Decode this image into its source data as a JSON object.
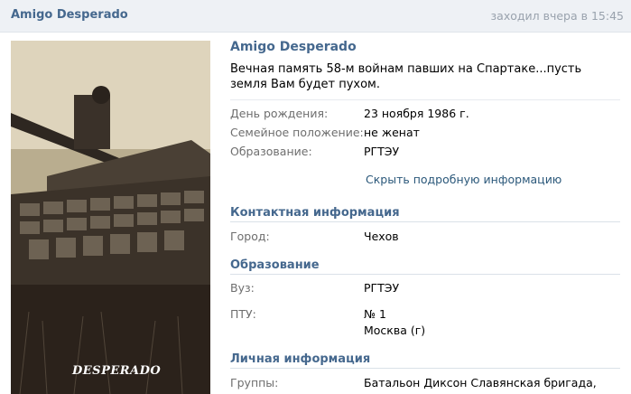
{
  "header": {
    "name": "Amigo Desperado",
    "status": "заходил вчера в 15:45"
  },
  "photo": {
    "caption": "DESPERADO"
  },
  "profile": {
    "name": "Amigo Desperado",
    "status_text": "Вечная память 58-м войнам павших на Спартаке...пусть земля Вам будет пухом.",
    "birthday_label": "День рождения:",
    "birthday_value": "23 ноября 1986 г.",
    "family_label": "Семейное положение:",
    "family_value": "не женат",
    "education_label": "Образование:",
    "education_value": "РГТЭУ",
    "toggle_link": "Скрыть подробную информацию"
  },
  "contact": {
    "title": "Контактная информация",
    "city_label": "Город:",
    "city_value": "Чехов"
  },
  "education": {
    "title": "Образование",
    "uni_label": "Вуз:",
    "uni_value": "РГТЭУ",
    "ptu_label": "ПТУ:",
    "ptu_value": "№ 1",
    "ptu_city": "Москва (г)"
  },
  "personal": {
    "title": "Личная информация",
    "groups_label": "Группы:",
    "groups_value": "Батальон Диксон Славянская бригада,"
  }
}
